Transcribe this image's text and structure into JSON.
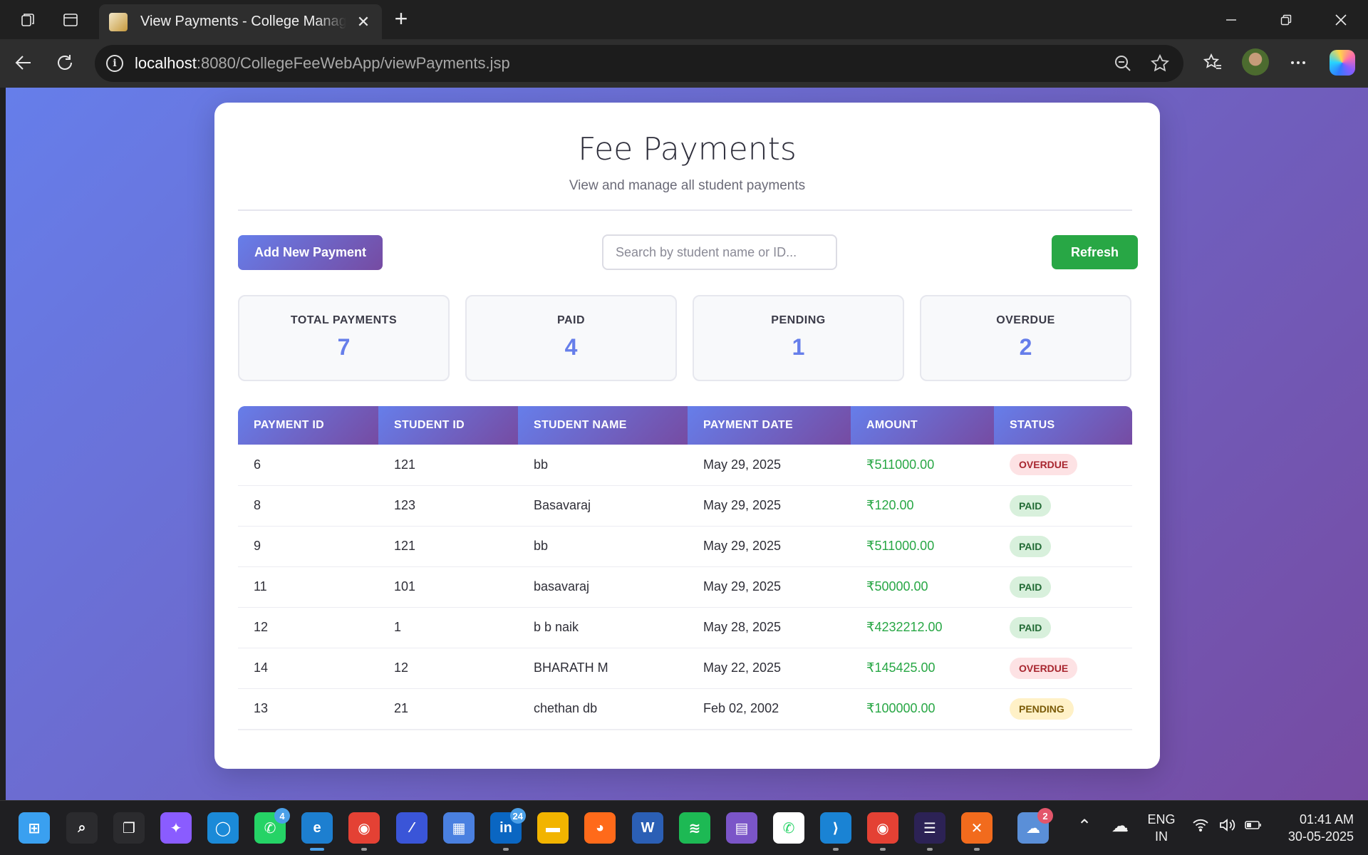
{
  "browser": {
    "tab_title": "View Payments - College Management",
    "tab_close": "✕",
    "new_tab": "+",
    "url_host": "localhost",
    "url_path": ":8080/CollegeFeeWebApp/viewPayments.jsp"
  },
  "page": {
    "title": "Fee Payments",
    "subtitle": "View and manage all student payments",
    "add_button": "Add New Payment",
    "search_placeholder": "Search by student name or ID...",
    "refresh_button": "Refresh"
  },
  "stats": [
    {
      "label": "TOTAL PAYMENTS",
      "value": "7"
    },
    {
      "label": "PAID",
      "value": "4"
    },
    {
      "label": "PENDING",
      "value": "1"
    },
    {
      "label": "OVERDUE",
      "value": "2"
    }
  ],
  "table": {
    "headers": [
      "PAYMENT ID",
      "STUDENT ID",
      "STUDENT NAME",
      "PAYMENT DATE",
      "AMOUNT",
      "STATUS"
    ],
    "rows": [
      {
        "payment_id": "6",
        "student_id": "121",
        "student_name": "bb",
        "date": "May 29, 2025",
        "amount": "₹511000.00",
        "status": "OVERDUE"
      },
      {
        "payment_id": "8",
        "student_id": "123",
        "student_name": "Basavaraj",
        "date": "May 29, 2025",
        "amount": "₹120.00",
        "status": "PAID"
      },
      {
        "payment_id": "9",
        "student_id": "121",
        "student_name": "bb",
        "date": "May 29, 2025",
        "amount": "₹511000.00",
        "status": "PAID"
      },
      {
        "payment_id": "11",
        "student_id": "101",
        "student_name": "basavaraj",
        "date": "May 29, 2025",
        "amount": "₹50000.00",
        "status": "PAID"
      },
      {
        "payment_id": "12",
        "student_id": "1",
        "student_name": "b b naik",
        "date": "May 28, 2025",
        "amount": "₹4232212.00",
        "status": "PAID"
      },
      {
        "payment_id": "14",
        "student_id": "12",
        "student_name": "BHARATH M",
        "date": "May 22, 2025",
        "amount": "₹145425.00",
        "status": "OVERDUE"
      },
      {
        "payment_id": "13",
        "student_id": "21",
        "student_name": "chethan db",
        "date": "Feb 02, 2002",
        "amount": "₹100000.00",
        "status": "PENDING"
      }
    ]
  },
  "taskbar": {
    "apps": [
      {
        "name": "start-icon",
        "glyph": "⊞",
        "color": "#3aa0f0"
      },
      {
        "name": "search-icon",
        "glyph": "⌕",
        "color": "#2b2b2e"
      },
      {
        "name": "task-view-icon",
        "glyph": "❐",
        "color": "#2b2b2e"
      },
      {
        "name": "copilot-icon",
        "glyph": "✦",
        "color": "#8a5cff"
      },
      {
        "name": "cortana-icon",
        "glyph": "◯",
        "color": "#1b8ad8"
      },
      {
        "name": "whatsapp-icon",
        "glyph": "✆",
        "color": "#25d366",
        "badge": "4"
      },
      {
        "name": "edge-icon",
        "glyph": "e",
        "color": "#1d7fd0",
        "active": true
      },
      {
        "name": "chrome-icon",
        "glyph": "◉",
        "color": "#e44134",
        "running": true
      },
      {
        "name": "dev-tool-icon",
        "glyph": "⁄",
        "color": "#3a55d8"
      },
      {
        "name": "store-icon",
        "glyph": "▦",
        "color": "#4a80e0"
      },
      {
        "name": "linkedin-icon",
        "glyph": "in",
        "color": "#0a66c2",
        "badge": "24",
        "running": true
      },
      {
        "name": "file-explorer-icon",
        "glyph": "▬",
        "color": "#f2b400"
      },
      {
        "name": "firefox-icon",
        "glyph": "◕",
        "color": "#ff6a1a"
      },
      {
        "name": "word-icon",
        "glyph": "W",
        "color": "#2b5fb5"
      },
      {
        "name": "spotify-icon",
        "glyph": "≋",
        "color": "#1db954"
      },
      {
        "name": "clapper-icon",
        "glyph": "▤",
        "color": "#7b55c8"
      },
      {
        "name": "whatsapp-desktop-icon",
        "glyph": "✆",
        "color": "#ffffff"
      },
      {
        "name": "vscode-icon",
        "glyph": "⟩",
        "color": "#1a83d4",
        "running": true
      },
      {
        "name": "chrome-profile-icon",
        "glyph": "◉",
        "color": "#e44134",
        "running": true
      },
      {
        "name": "eclipse-icon",
        "glyph": "☰",
        "color": "#2c2255",
        "running": true
      },
      {
        "name": "xampp-icon",
        "glyph": "✕",
        "color": "#f26b1d",
        "running": true
      },
      {
        "name": "weather-icon",
        "glyph": "☁",
        "color": "#5a8fd8",
        "badge": "2"
      }
    ],
    "lang_line1": "ENG",
    "lang_line2": "IN",
    "time": "01:41 AM",
    "date": "30-05-2025"
  }
}
